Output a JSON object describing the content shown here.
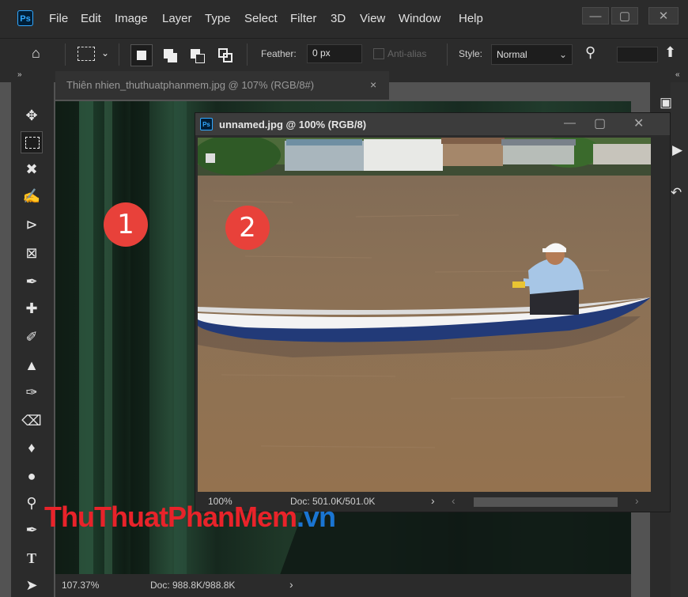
{
  "app": {
    "logo_text": "Ps",
    "menu": [
      "File",
      "Edit",
      "Image",
      "Layer",
      "Type",
      "Select",
      "Filter",
      "3D",
      "View",
      "Window",
      "Help"
    ]
  },
  "options_bar": {
    "feather_label": "Feather:",
    "feather_value": "0 px",
    "anti_alias_label": "Anti-alias",
    "style_label": "Style:",
    "style_value": "Normal"
  },
  "doc_tab": {
    "title": "Thiên nhien_thuthuatphanmem.jpg @ 107% (RGB/8#)",
    "close": "×"
  },
  "status_main": {
    "zoom": "107.37%",
    "doc": "Doc: 988.8K/988.8K",
    "arrow": "›"
  },
  "float_window": {
    "logo_text": "Ps",
    "title": "unnamed.jpg @ 100% (RGB/8)",
    "zoom": "100%",
    "doc": "Doc: 501.0K/501.0K",
    "arrow": "›"
  },
  "badges": {
    "one": "1",
    "two": "2"
  },
  "watermark": {
    "part1": "Thu",
    "part2": "ThuatPhanMem",
    "part3": ".vn"
  },
  "colors": {
    "accent": "#31a8ff",
    "badge": "#e8413a",
    "water": "#8a6f55"
  }
}
